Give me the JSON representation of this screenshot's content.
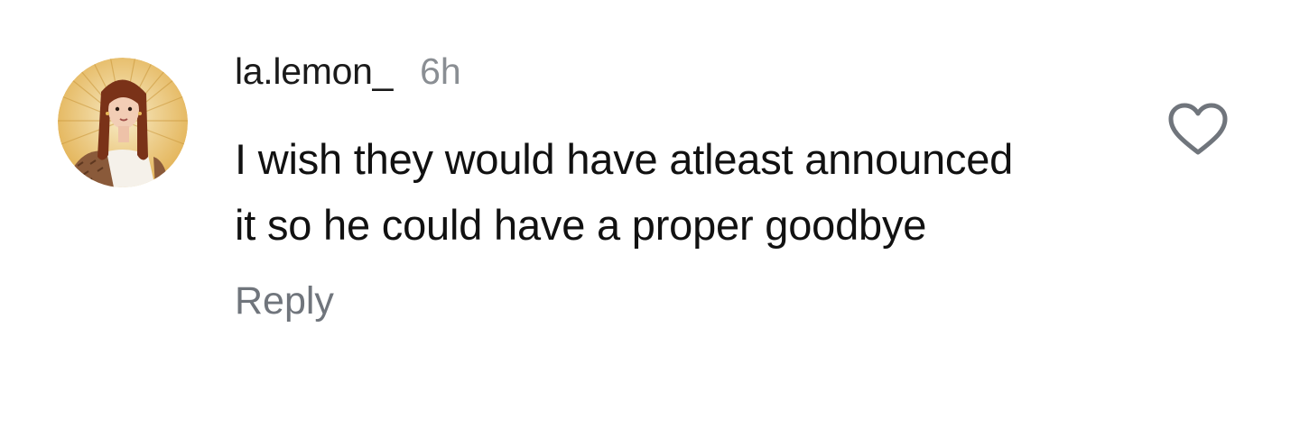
{
  "comment": {
    "username": "la.lemon_",
    "time": "6h",
    "text": "I wish they would have atleast announced it so he could have a proper goodbye",
    "reply_label": "Reply",
    "avatar_icon": "avatar-illustration-icon",
    "like_icon": "heart-outline-icon",
    "colors": {
      "username": "#1a1a1a",
      "time": "#8a8e93",
      "text": "#111111",
      "reply": "#70757c",
      "like_stroke": "#70757c",
      "avatar_bg": "#e7b95a"
    }
  }
}
